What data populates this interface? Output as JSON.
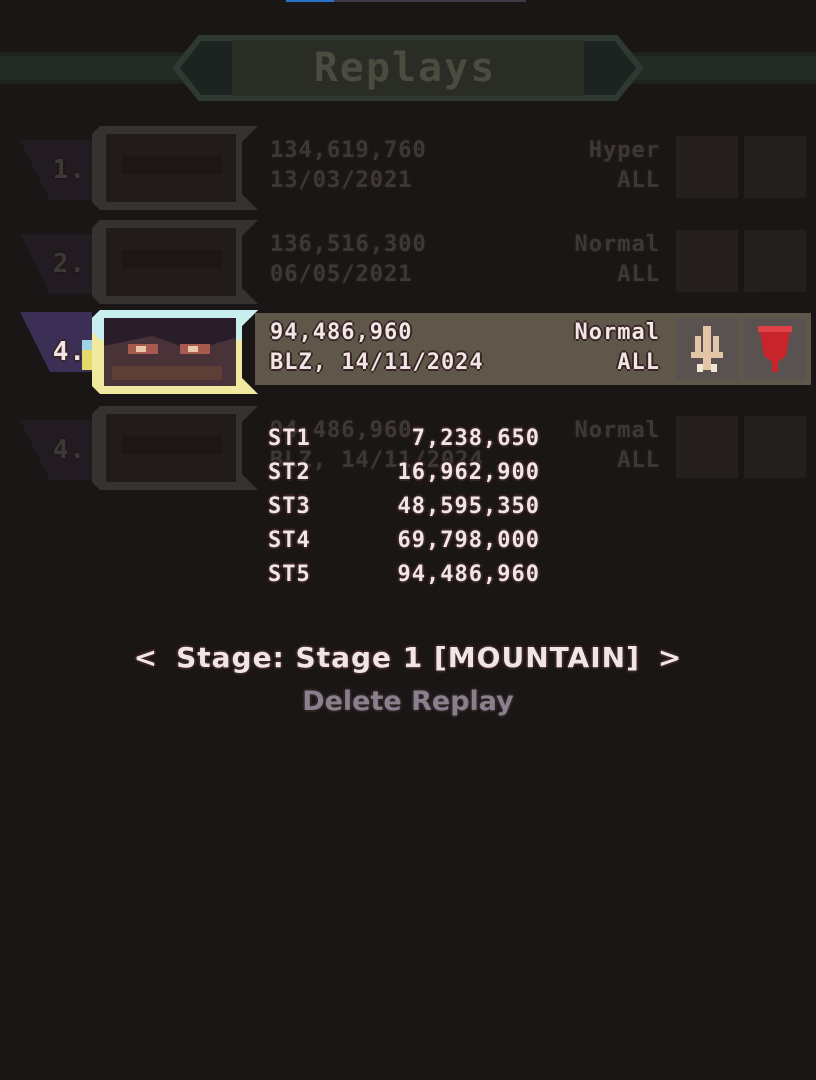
{
  "header": {
    "title": "Replays"
  },
  "replays": [
    {
      "rank": "1.",
      "score": "134,619,760",
      "date": "13/03/2021",
      "difficulty": "Hyper",
      "stages": "ALL"
    },
    {
      "rank": "2.",
      "score": "136,516,300",
      "date": "06/05/2021",
      "difficulty": "Normal",
      "stages": "ALL"
    },
    {
      "rank": "4.",
      "score": "94,486,960",
      "date": "BLZ, 14/11/2024",
      "difficulty": "Normal",
      "stages": "ALL"
    },
    {
      "rank": "4.",
      "score": "94,486,960",
      "date": "BLZ, 14/11/2024",
      "difficulty": "Normal",
      "stages": "ALL"
    }
  ],
  "stage_scores": [
    {
      "label": "ST1",
      "value": "7,238,650"
    },
    {
      "label": "ST2",
      "value": "16,962,900"
    },
    {
      "label": "ST3",
      "value": "48,595,350"
    },
    {
      "label": "ST4",
      "value": "69,798,000"
    },
    {
      "label": "ST5",
      "value": "94,486,960"
    }
  ],
  "stage_selector": {
    "prev": "<",
    "label": "Stage: Stage 1 [MOUNTAIN]",
    "next": ">"
  },
  "delete_label": "Delete Replay",
  "colors": {
    "background": "#1b1616",
    "selected_row": "#5f574a",
    "bomb_red": "#c8242c",
    "portrait_frame": "#f0e9a0",
    "text": "#f0e6e6",
    "delete_text": "#8a7f8c"
  }
}
